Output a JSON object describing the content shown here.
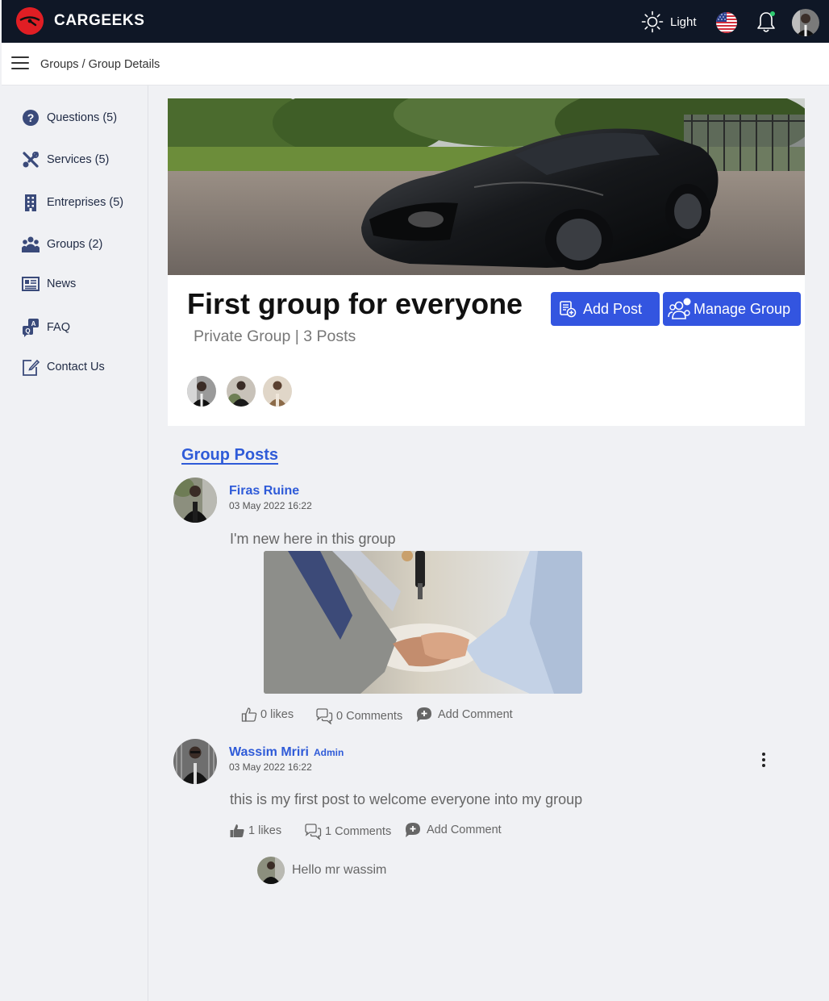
{
  "app": {
    "brand": "CARGEEKS"
  },
  "header": {
    "theme_label": "Light",
    "language": "en-US flag",
    "notification_dot": "#2ecc71"
  },
  "breadcrumb": "Groups / Group Details",
  "sidebar": {
    "items": [
      {
        "label": "Questions (5)",
        "icon": "question-circle-icon"
      },
      {
        "label": "Services (5)",
        "icon": "tools-icon"
      },
      {
        "label": "Entreprises (5)",
        "icon": "building-icon"
      },
      {
        "label": "Groups (2)",
        "icon": "people-group-icon"
      },
      {
        "label": "News",
        "icon": "newspaper-icon"
      },
      {
        "label": "FAQ",
        "icon": "faq-icon"
      },
      {
        "label": "Contact Us",
        "icon": "edit-icon"
      }
    ]
  },
  "group": {
    "title": "First group for everyone",
    "meta": "Private Group | 3 Posts",
    "add_post_label": "Add Post",
    "manage_group_label": "Manage Group",
    "member_count_shown": 3
  },
  "posts_section_title": "Group Posts",
  "posts": [
    {
      "author": "Firas Ruine",
      "date": "03 May 2022 16:22",
      "text": "I'm new here in this group",
      "has_image": true,
      "likes": "0 likes",
      "comments": "0 Comments",
      "add_comment": "Add Comment"
    },
    {
      "author": "Wassim Mriri",
      "badge": "Admin",
      "date": "03 May 2022 16:22",
      "text": "this is my first post to welcome everyone into my group",
      "likes": "1 likes",
      "comments": "1 Comments",
      "add_comment": "Add Comment",
      "comment_preview": "Hello mr wassim"
    }
  ],
  "colors": {
    "accent": "#3355e0",
    "link": "#2f5bd8",
    "topbar": "#0f1726",
    "brand_logo": "#e01e24"
  }
}
